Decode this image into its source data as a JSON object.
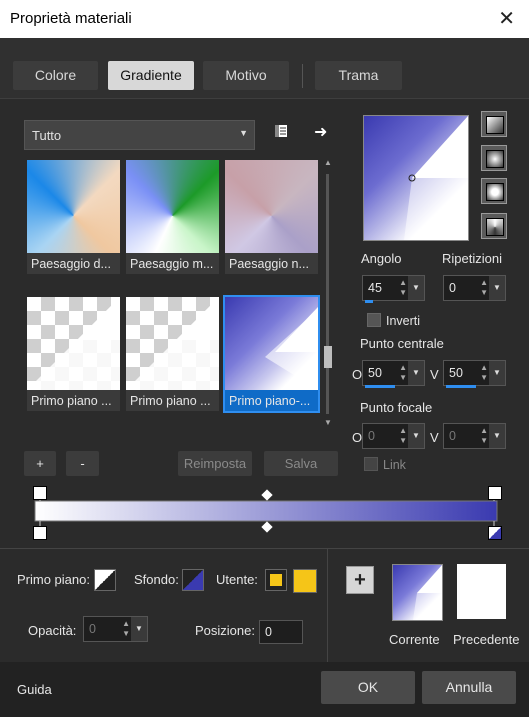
{
  "window": {
    "title": "Proprietà materiali",
    "close_icon": "close-icon"
  },
  "tabs": [
    {
      "label": "Colore",
      "active": false
    },
    {
      "label": "Gradiente",
      "active": true
    },
    {
      "label": "Motivo",
      "active": false
    },
    {
      "label": "Trama",
      "active": false
    }
  ],
  "category": {
    "selected": "Tutto"
  },
  "gallery": [
    {
      "label": "Paesaggio d..."
    },
    {
      "label": "Paesaggio m..."
    },
    {
      "label": "Paesaggio n..."
    },
    {
      "label": "Primo piano ..."
    },
    {
      "label": "Primo piano ..."
    },
    {
      "label": "Primo piano-..."
    }
  ],
  "gallery_buttons": {
    "add": "+",
    "remove": "-",
    "reset": "Reimposta",
    "save": "Salva"
  },
  "angle": {
    "label": "Angolo",
    "value": "45"
  },
  "repeats": {
    "label": "Ripetizioni",
    "value": "0"
  },
  "invert": {
    "label": "Inverti",
    "checked": false
  },
  "center_point": {
    "label": "Punto centrale",
    "o_label": "O",
    "o_value": "50",
    "v_label": "V",
    "v_value": "50"
  },
  "focal_point": {
    "label": "Punto focale",
    "o_label": "O",
    "o_value": "0",
    "v_label": "V",
    "v_value": "0"
  },
  "link": {
    "label": "Link",
    "checked": false
  },
  "bottom": {
    "foreground_label": "Primo piano:",
    "background_label": "Sfondo:",
    "user_label": "Utente:",
    "opacity_label": "Opacità:",
    "opacity_value": "0",
    "position_label": "Posizione:",
    "position_value": "0",
    "current_label": "Corrente",
    "previous_label": "Precedente"
  },
  "footer": {
    "help": "Guida",
    "ok": "OK",
    "cancel": "Annulla"
  },
  "colors": {
    "accent": "#2f8ef0",
    "gradient_blue": "#3c3cb0",
    "user_color": "#f5c518"
  }
}
